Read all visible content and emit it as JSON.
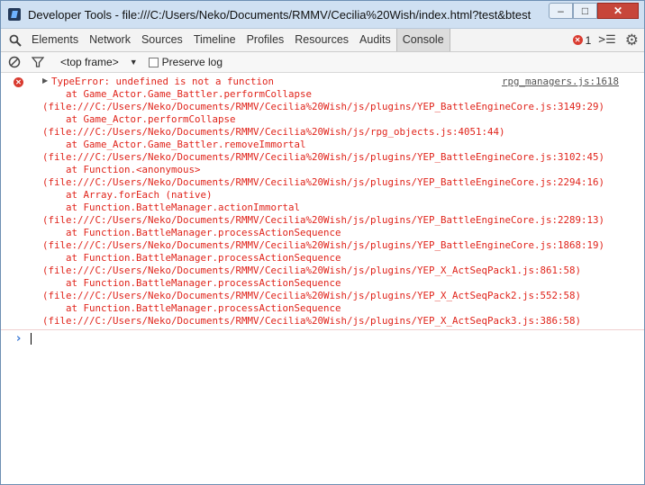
{
  "window": {
    "title": "Developer Tools - file:///C:/Users/Neko/Documents/RMMV/Cecilia%20Wish/index.html?test&btest",
    "minimize": "–",
    "maximize": "□",
    "close": "✕"
  },
  "tabs": [
    "Elements",
    "Network",
    "Sources",
    "Timeline",
    "Profiles",
    "Resources",
    "Audits",
    "Console"
  ],
  "selected_tab": "Console",
  "error_count": "1",
  "filterbar": {
    "frame": "<top frame>",
    "preserve_log": "Preserve log",
    "preserve_checked": false
  },
  "console": {
    "source_link": "rpg_managers.js:1618",
    "lines": [
      "TypeError: undefined is not a function",
      "    at Game_Actor.Game_Battler.performCollapse",
      "(file:///C:/Users/Neko/Documents/RMMV/Cecilia%20Wish/js/plugins/YEP_BattleEngineCore.js:3149:29)",
      "    at Game_Actor.performCollapse",
      "(file:///C:/Users/Neko/Documents/RMMV/Cecilia%20Wish/js/rpg_objects.js:4051:44)",
      "    at Game_Actor.Game_Battler.removeImmortal",
      "(file:///C:/Users/Neko/Documents/RMMV/Cecilia%20Wish/js/plugins/YEP_BattleEngineCore.js:3102:45)",
      "    at Function.<anonymous>",
      "(file:///C:/Users/Neko/Documents/RMMV/Cecilia%20Wish/js/plugins/YEP_BattleEngineCore.js:2294:16)",
      "    at Array.forEach (native)",
      "    at Function.BattleManager.actionImmortal",
      "(file:///C:/Users/Neko/Documents/RMMV/Cecilia%20Wish/js/plugins/YEP_BattleEngineCore.js:2289:13)",
      "    at Function.BattleManager.processActionSequence",
      "(file:///C:/Users/Neko/Documents/RMMV/Cecilia%20Wish/js/plugins/YEP_BattleEngineCore.js:1868:19)",
      "    at Function.BattleManager.processActionSequence",
      "(file:///C:/Users/Neko/Documents/RMMV/Cecilia%20Wish/js/plugins/YEP_X_ActSeqPack1.js:861:58)",
      "    at Function.BattleManager.processActionSequence",
      "(file:///C:/Users/Neko/Documents/RMMV/Cecilia%20Wish/js/plugins/YEP_X_ActSeqPack2.js:552:58)",
      "    at Function.BattleManager.processActionSequence",
      "(file:///C:/Users/Neko/Documents/RMMV/Cecilia%20Wish/js/plugins/YEP_X_ActSeqPack3.js:386:58)"
    ]
  },
  "colors": {
    "error": "#e0241b",
    "prompt": "#3b7ad6",
    "titlebar": "#cfe0f2"
  }
}
